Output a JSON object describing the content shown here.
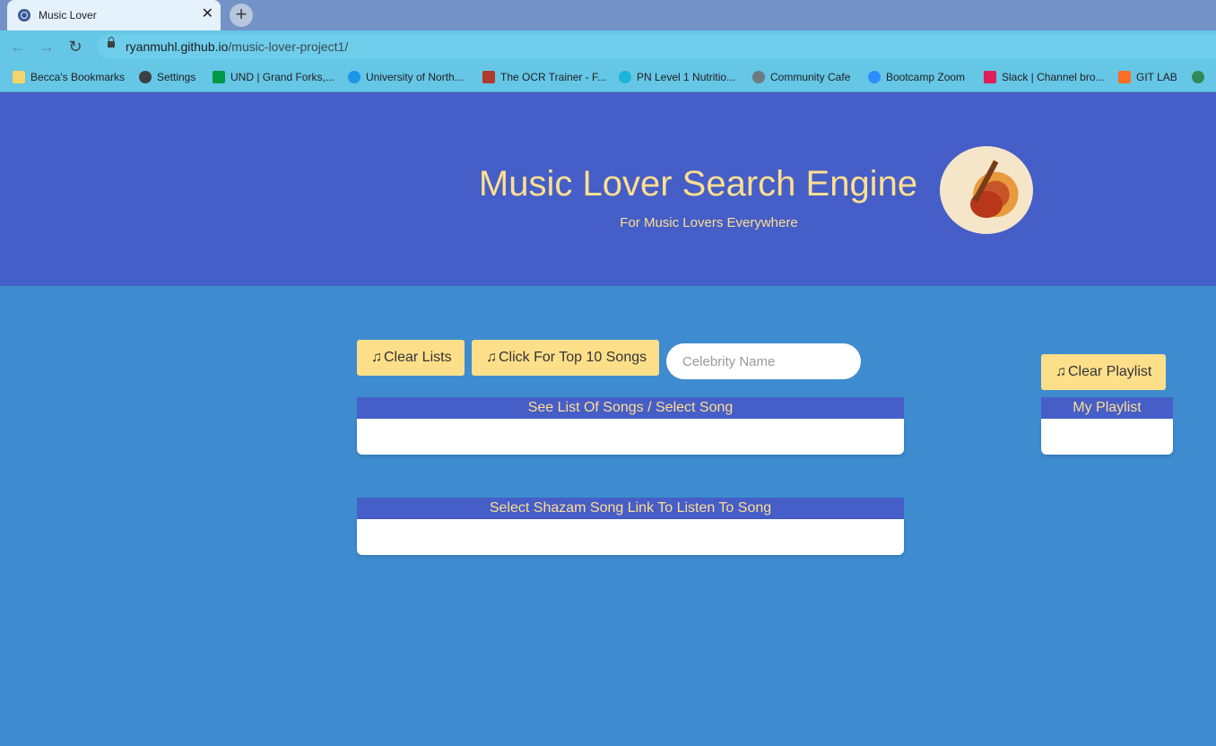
{
  "browser": {
    "tab_title": "Music Lover",
    "tab_close": "✕",
    "new_tab": "+",
    "url_host": "ryanmuhl.github.io",
    "url_path": "/music-lover-project1/"
  },
  "bookmarks": [
    {
      "label": "Becca's Bookmarks",
      "icon": "folder-icon",
      "color": "#f7d46b"
    },
    {
      "label": "Settings",
      "icon": "gear-icon",
      "color": "#3c4043"
    },
    {
      "label": "UND | Grand Forks,...",
      "icon": "und-icon",
      "color": "#009a44"
    },
    {
      "label": "University of North...",
      "icon": "cloud-icon",
      "color": "#1b96e8"
    },
    {
      "label": "The OCR Trainer - F...",
      "icon": "ocr-icon",
      "color": "#b23a2a"
    },
    {
      "label": "PN Level 1 Nutritio...",
      "icon": "pn-icon",
      "color": "#1db4d8"
    },
    {
      "label": "Community Cafe",
      "icon": "cafe-icon",
      "color": "#6b7b7f"
    },
    {
      "label": "Bootcamp Zoom",
      "icon": "zoom-icon",
      "color": "#2d8cff"
    },
    {
      "label": "Slack | Channel bro...",
      "icon": "slack-icon",
      "color": "#e01e5a"
    },
    {
      "label": "GIT LAB",
      "icon": "gitlab-icon",
      "color": "#fc6d26"
    }
  ],
  "header": {
    "title": "Music Lover Search Engine",
    "subtitle": "For Music Lovers Everywhere"
  },
  "controls": {
    "clear_lists": "Clear Lists",
    "top10": "Click For Top 10 Songs",
    "celebrity_placeholder": "Celebrity Name",
    "clear_playlist": "Clear Playlist",
    "note_glyph": "♫"
  },
  "panels": {
    "songs_heading": "See List Of Songs / Select Song",
    "shazam_heading": "Select Shazam Song Link To Listen To Song",
    "playlist_heading": "My Playlist"
  },
  "colors": {
    "header_bg": "#465ec7",
    "page_bg": "#3e8ccf",
    "accent_text": "#fddf91",
    "button_bg": "#fddf8a"
  }
}
